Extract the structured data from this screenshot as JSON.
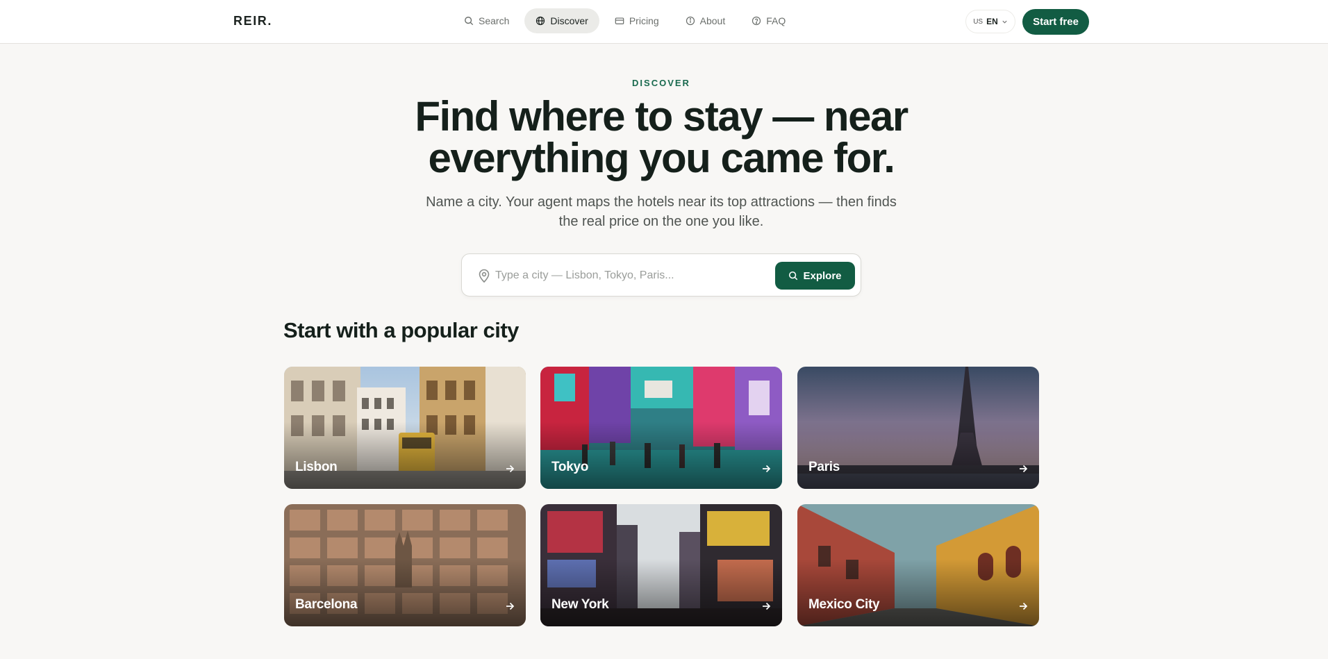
{
  "header": {
    "logo": "REIR.",
    "nav": [
      {
        "label": "Search",
        "icon": "search-icon",
        "active": false
      },
      {
        "label": "Discover",
        "icon": "globe-icon",
        "active": true
      },
      {
        "label": "Pricing",
        "icon": "card-icon",
        "active": false
      },
      {
        "label": "About",
        "icon": "info-icon",
        "active": false
      },
      {
        "label": "FAQ",
        "icon": "help-icon",
        "active": false
      }
    ],
    "language": {
      "flag": "US",
      "code": "EN"
    },
    "start_label": "Start free"
  },
  "hero": {
    "eyebrow": "DISCOVER",
    "headline": "Find where to stay — near everything you came for.",
    "subhead": "Name a city. Your agent maps the hotels near its top attractions — then finds the real price on the one you like."
  },
  "search": {
    "placeholder": "Type a city — Lisbon, Tokyo, Paris...",
    "value": "",
    "button_label": "Explore"
  },
  "popular": {
    "title": "Start with a popular city",
    "cities": [
      {
        "name": "Lisbon"
      },
      {
        "name": "Tokyo"
      },
      {
        "name": "Paris"
      },
      {
        "name": "Barcelona"
      },
      {
        "name": "New York"
      },
      {
        "name": "Mexico City"
      }
    ]
  },
  "colors": {
    "brand": "#125c43",
    "eyebrow": "#1a6a4f",
    "background": "#f8f7f5",
    "text": "#15201b"
  }
}
